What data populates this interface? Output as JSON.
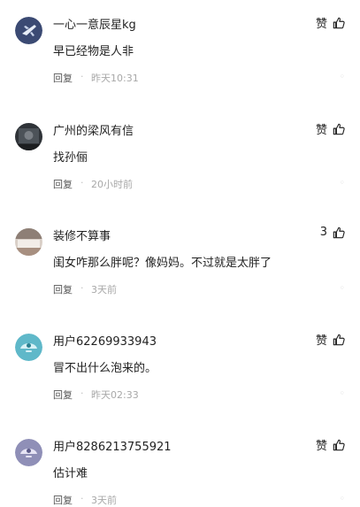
{
  "comments": [
    {
      "username": "一心一意辰星kg",
      "text": "早已经物是人非",
      "like": "赞",
      "reply": "回复",
      "dot": "·",
      "time": "昨天10:31",
      "avatar": "plane-avatar"
    },
    {
      "username": "广州的梁风有信",
      "text": "找孙俪",
      "like": "赞",
      "reply": "回复",
      "dot": "·",
      "time": "20小时前",
      "avatar": "portrait-avatar"
    },
    {
      "username": "装修不算事",
      "text": "闺女咋那么胖呢？像妈妈。不过就是太胖了",
      "like": "3",
      "reply": "回复",
      "dot": "·",
      "time": "3天前",
      "avatar": "room-avatar"
    },
    {
      "username": "用户62269933943",
      "text": "冒不出什么泡来的。",
      "like": "赞",
      "reply": "回复",
      "dot": "·",
      "time": "昨天02:33",
      "avatar": "default-teal-avatar"
    },
    {
      "username": "用户8286213755921",
      "text": "估计难",
      "like": "赞",
      "reply": "回复",
      "dot": "·",
      "time": "3天前",
      "avatar": "default-purple-avatar"
    }
  ],
  "more_glyph": "◦"
}
